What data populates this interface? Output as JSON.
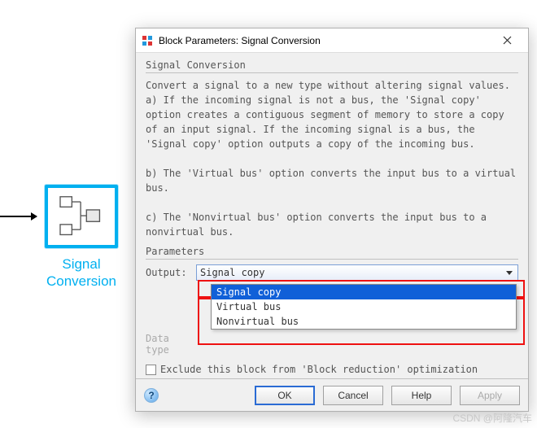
{
  "block": {
    "label": "Signal\nConversion"
  },
  "dialog": {
    "title": "Block Parameters: Signal Conversion",
    "section1_title": "Signal Conversion",
    "description": "Convert a signal to a new type without altering signal values.\na) If the incoming signal is not a bus, the 'Signal copy' option creates a contiguous segment of memory to store a copy of an input signal. If the incoming signal is a bus, the 'Signal copy' option outputs a copy of the incoming bus.\n\nb) The 'Virtual bus' option converts the input bus to a virtual bus.\n\nc) The 'Nonvirtual bus' option converts the input bus to a nonvirtual bus.",
    "params_title": "Parameters",
    "output_label": "Output:",
    "output_value": "Signal copy",
    "options": [
      "Signal copy",
      "Virtual bus",
      "Nonvirtual bus"
    ],
    "datatype_label": "Data type",
    "checkbox_label": "Exclude this block from 'Block reduction' optimization",
    "buttons": {
      "ok": "OK",
      "cancel": "Cancel",
      "help": "Help",
      "apply": "Apply"
    }
  },
  "watermark": "CSDN @阿隆汽车"
}
